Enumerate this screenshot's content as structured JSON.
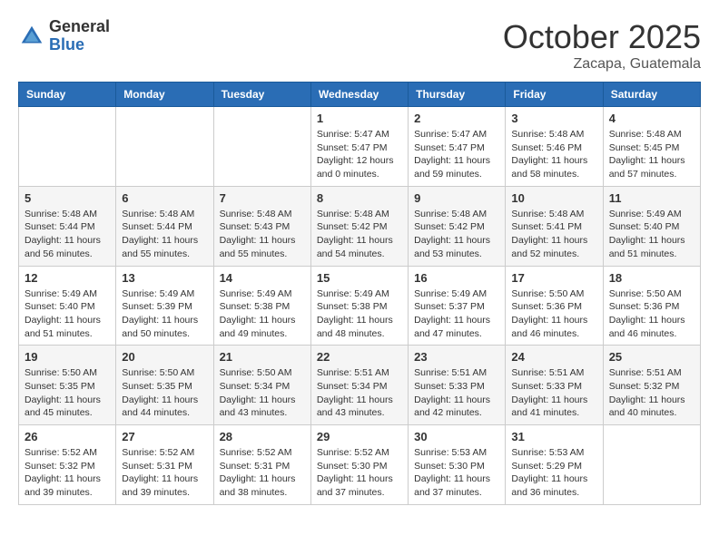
{
  "header": {
    "logo_general": "General",
    "logo_blue": "Blue",
    "month_title": "October 2025",
    "location": "Zacapa, Guatemala"
  },
  "days_of_week": [
    "Sunday",
    "Monday",
    "Tuesday",
    "Wednesday",
    "Thursday",
    "Friday",
    "Saturday"
  ],
  "weeks": [
    [
      {
        "day": "",
        "info": ""
      },
      {
        "day": "",
        "info": ""
      },
      {
        "day": "",
        "info": ""
      },
      {
        "day": "1",
        "info": "Sunrise: 5:47 AM\nSunset: 5:47 PM\nDaylight: 12 hours\nand 0 minutes."
      },
      {
        "day": "2",
        "info": "Sunrise: 5:47 AM\nSunset: 5:47 PM\nDaylight: 11 hours\nand 59 minutes."
      },
      {
        "day": "3",
        "info": "Sunrise: 5:48 AM\nSunset: 5:46 PM\nDaylight: 11 hours\nand 58 minutes."
      },
      {
        "day": "4",
        "info": "Sunrise: 5:48 AM\nSunset: 5:45 PM\nDaylight: 11 hours\nand 57 minutes."
      }
    ],
    [
      {
        "day": "5",
        "info": "Sunrise: 5:48 AM\nSunset: 5:44 PM\nDaylight: 11 hours\nand 56 minutes."
      },
      {
        "day": "6",
        "info": "Sunrise: 5:48 AM\nSunset: 5:44 PM\nDaylight: 11 hours\nand 55 minutes."
      },
      {
        "day": "7",
        "info": "Sunrise: 5:48 AM\nSunset: 5:43 PM\nDaylight: 11 hours\nand 55 minutes."
      },
      {
        "day": "8",
        "info": "Sunrise: 5:48 AM\nSunset: 5:42 PM\nDaylight: 11 hours\nand 54 minutes."
      },
      {
        "day": "9",
        "info": "Sunrise: 5:48 AM\nSunset: 5:42 PM\nDaylight: 11 hours\nand 53 minutes."
      },
      {
        "day": "10",
        "info": "Sunrise: 5:48 AM\nSunset: 5:41 PM\nDaylight: 11 hours\nand 52 minutes."
      },
      {
        "day": "11",
        "info": "Sunrise: 5:49 AM\nSunset: 5:40 PM\nDaylight: 11 hours\nand 51 minutes."
      }
    ],
    [
      {
        "day": "12",
        "info": "Sunrise: 5:49 AM\nSunset: 5:40 PM\nDaylight: 11 hours\nand 51 minutes."
      },
      {
        "day": "13",
        "info": "Sunrise: 5:49 AM\nSunset: 5:39 PM\nDaylight: 11 hours\nand 50 minutes."
      },
      {
        "day": "14",
        "info": "Sunrise: 5:49 AM\nSunset: 5:38 PM\nDaylight: 11 hours\nand 49 minutes."
      },
      {
        "day": "15",
        "info": "Sunrise: 5:49 AM\nSunset: 5:38 PM\nDaylight: 11 hours\nand 48 minutes."
      },
      {
        "day": "16",
        "info": "Sunrise: 5:49 AM\nSunset: 5:37 PM\nDaylight: 11 hours\nand 47 minutes."
      },
      {
        "day": "17",
        "info": "Sunrise: 5:50 AM\nSunset: 5:36 PM\nDaylight: 11 hours\nand 46 minutes."
      },
      {
        "day": "18",
        "info": "Sunrise: 5:50 AM\nSunset: 5:36 PM\nDaylight: 11 hours\nand 46 minutes."
      }
    ],
    [
      {
        "day": "19",
        "info": "Sunrise: 5:50 AM\nSunset: 5:35 PM\nDaylight: 11 hours\nand 45 minutes."
      },
      {
        "day": "20",
        "info": "Sunrise: 5:50 AM\nSunset: 5:35 PM\nDaylight: 11 hours\nand 44 minutes."
      },
      {
        "day": "21",
        "info": "Sunrise: 5:50 AM\nSunset: 5:34 PM\nDaylight: 11 hours\nand 43 minutes."
      },
      {
        "day": "22",
        "info": "Sunrise: 5:51 AM\nSunset: 5:34 PM\nDaylight: 11 hours\nand 43 minutes."
      },
      {
        "day": "23",
        "info": "Sunrise: 5:51 AM\nSunset: 5:33 PM\nDaylight: 11 hours\nand 42 minutes."
      },
      {
        "day": "24",
        "info": "Sunrise: 5:51 AM\nSunset: 5:33 PM\nDaylight: 11 hours\nand 41 minutes."
      },
      {
        "day": "25",
        "info": "Sunrise: 5:51 AM\nSunset: 5:32 PM\nDaylight: 11 hours\nand 40 minutes."
      }
    ],
    [
      {
        "day": "26",
        "info": "Sunrise: 5:52 AM\nSunset: 5:32 PM\nDaylight: 11 hours\nand 39 minutes."
      },
      {
        "day": "27",
        "info": "Sunrise: 5:52 AM\nSunset: 5:31 PM\nDaylight: 11 hours\nand 39 minutes."
      },
      {
        "day": "28",
        "info": "Sunrise: 5:52 AM\nSunset: 5:31 PM\nDaylight: 11 hours\nand 38 minutes."
      },
      {
        "day": "29",
        "info": "Sunrise: 5:52 AM\nSunset: 5:30 PM\nDaylight: 11 hours\nand 37 minutes."
      },
      {
        "day": "30",
        "info": "Sunrise: 5:53 AM\nSunset: 5:30 PM\nDaylight: 11 hours\nand 37 minutes."
      },
      {
        "day": "31",
        "info": "Sunrise: 5:53 AM\nSunset: 5:29 PM\nDaylight: 11 hours\nand 36 minutes."
      },
      {
        "day": "",
        "info": ""
      }
    ]
  ]
}
